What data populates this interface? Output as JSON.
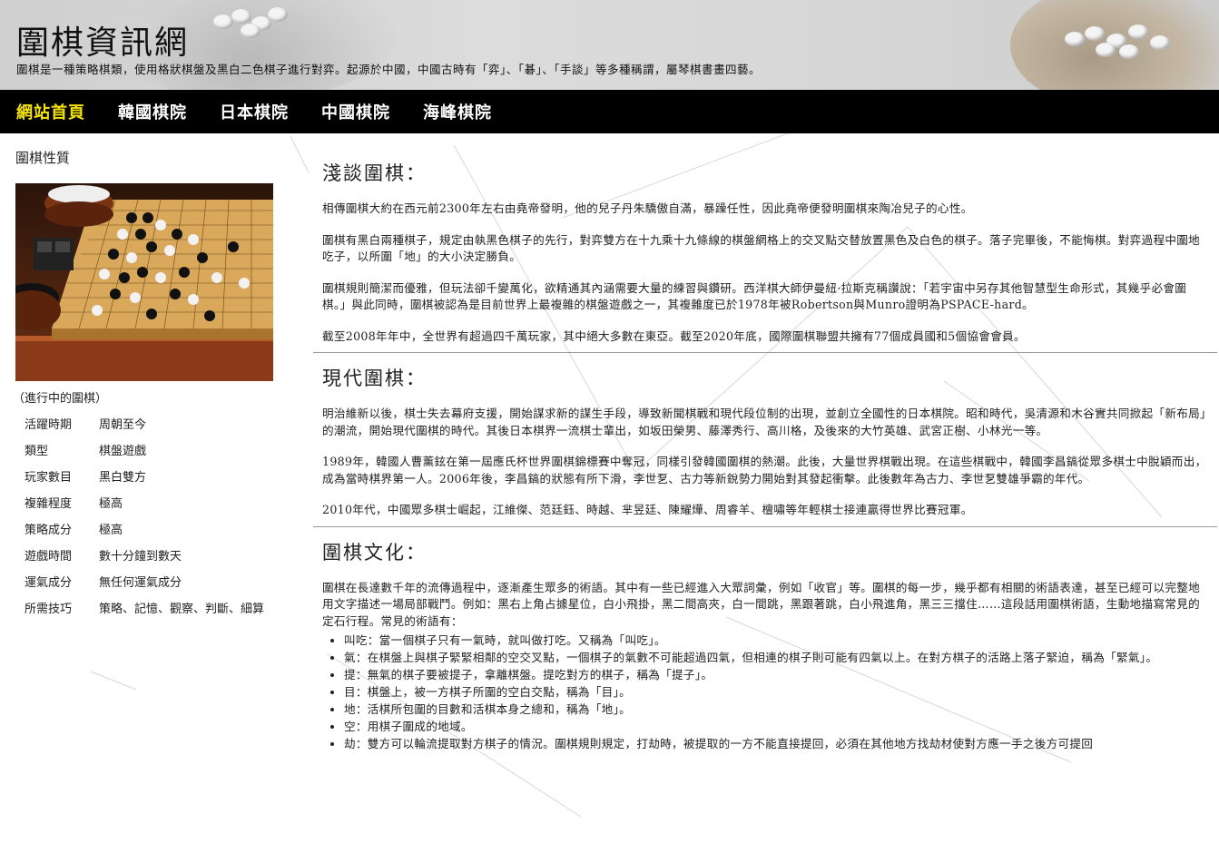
{
  "site": {
    "title": "圍棋資訊網",
    "description": "圍棋是一種策略棋類，使用格狀棋盤及黑白二色棋子進行對弈。起源於中國，中國古時有「弈」、「碁」、「手談」等多種稱謂，屬琴棋書畫四藝。"
  },
  "nav": {
    "items": [
      {
        "label": "網站首頁",
        "active": true
      },
      {
        "label": "韓國棋院",
        "active": false
      },
      {
        "label": "日本棋院",
        "active": false
      },
      {
        "label": "中國棋院",
        "active": false
      },
      {
        "label": "海峰棋院",
        "active": false
      }
    ],
    "active_color": "#f5e20a"
  },
  "sidebar": {
    "heading": "圍棋性質",
    "caption": "（進行中的圍棋）",
    "properties": [
      {
        "key": "活躍時期",
        "value": "周朝至今"
      },
      {
        "key": "類型",
        "value": "棋盤遊戲"
      },
      {
        "key": "玩家數目",
        "value": "黑白雙方"
      },
      {
        "key": "複雜程度",
        "value": "極高"
      },
      {
        "key": "策略成分",
        "value": "極高"
      },
      {
        "key": "遊戲時間",
        "value": "數十分鐘到數天"
      },
      {
        "key": "運氣成分",
        "value": "無任何運氣成分"
      },
      {
        "key": "所需技巧",
        "value": "策略、記憶、觀察、判斷、細算"
      }
    ]
  },
  "sections": [
    {
      "title": "淺談圍棋：",
      "paragraphs": [
        "相傳圍棋大約在西元前2300年左右由堯帝發明，他的兒子丹朱驕傲自滿，暴躁任性，因此堯帝便發明圍棋來陶冶兒子的心性。",
        "圍棋有黑白兩種棋子，規定由執黑色棋子的先行，對弈雙方在十九乘十九條線的棋盤網格上的交叉點交替放置黑色及白色的棋子。落子完畢後，不能悔棋。對弈過程中圍地吃子，以所圍「地」的大小決定勝負。",
        "圍棋規則簡潔而優雅，但玩法卻千變萬化，欲精通其內涵需要大量的練習與鑽研。西洋棋大師伊曼紐·拉斯克稱讚說：「若宇宙中另存其他智慧型生命形式，其幾乎必會圍棋。」與此同時，圍棋被認為是目前世界上最複雜的棋盤遊戲之一，其複雜度已於1978年被Robertson與Munro證明為PSPACE-hard。",
        "截至2008年年中，全世界有超過四千萬玩家，其中絕大多數在東亞。截至2020年底，國際圍棋聯盟共擁有77個成員國和5個協會會員。"
      ]
    },
    {
      "title": "現代圍棋：",
      "paragraphs": [
        "明治維新以後，棋士失去幕府支援，開始謀求新的謀生手段，導致新聞棋戰和現代段位制的出現，並創立全國性的日本棋院。昭和時代，吳清源和木谷實共同掀起「新布局」的潮流，開始現代圍棋的時代。其後日本棋界一流棋士輩出，如坂田榮男、藤澤秀行、高川格，及後來的大竹英雄、武宮正樹、小林光一等。",
        "1989年，韓國人曹薰鉉在第一屆應氏杯世界圍棋錦標賽中奪冠，同樣引發韓國圍棋的熱潮。此後，大量世界棋戰出現。在這些棋戰中，韓國李昌鎬從眾多棋士中脫穎而出，成為當時棋界第一人。2006年後，李昌鎬的狀態有所下滑，李世乭、古力等新銳勢力開始對其發起衝擊。此後數年為古力、李世乭雙雄爭霸的年代。",
        "2010年代，中國眾多棋士崛起，江維傑、范廷鈺、時越、芈昱廷、陳耀燁、周睿羊、檀嘯等年輕棋士接連贏得世界比賽冠軍。"
      ]
    },
    {
      "title": "圍棋文化：",
      "paragraphs": [
        "圍棋在長達數千年的流傳過程中，逐漸產生眾多的術語。其中有一些已經進入大眾詞彙，例如「收官」等。圍棋的每一步，幾乎都有相關的術語表達，甚至已經可以完整地用文字描述一場局部戰鬥。例如：黑右上角占據星位，白小飛掛，黑二間高夾，白一間跳，黑跟著跳，白小飛進角，黑三三擋住……這段話用圍棋術語，生動地描寫常見的定石行程。常見的術語有："
      ],
      "terms": [
        "叫吃：當一個棋子只有一氣時，就叫做打吃。又稱為「叫吃」。",
        "氣：在棋盤上與棋子緊緊相鄰的空交叉點，一個棋子的氣數不可能超過四氣，但相連的棋子則可能有四氣以上。在對方棋子的活路上落子緊迫，稱為「緊氣」。",
        "提：無氣的棋子要被提子，拿離棋盤。提吃對方的棋子，稱為「提子」。",
        "目：棋盤上，被一方棋子所圍的空白交點，稱為「目」。",
        "地：活棋所包圍的目數和活棋本身之總和，稱為「地」。",
        "空：用棋子圍成的地域。",
        "劫：雙方可以輪流提取對方棋子的情況。圍棋規則規定，打劫時，被提取的一方不能直接提回，必須在其他地方找劫材使對方應一手之後方可提回"
      ]
    }
  ]
}
